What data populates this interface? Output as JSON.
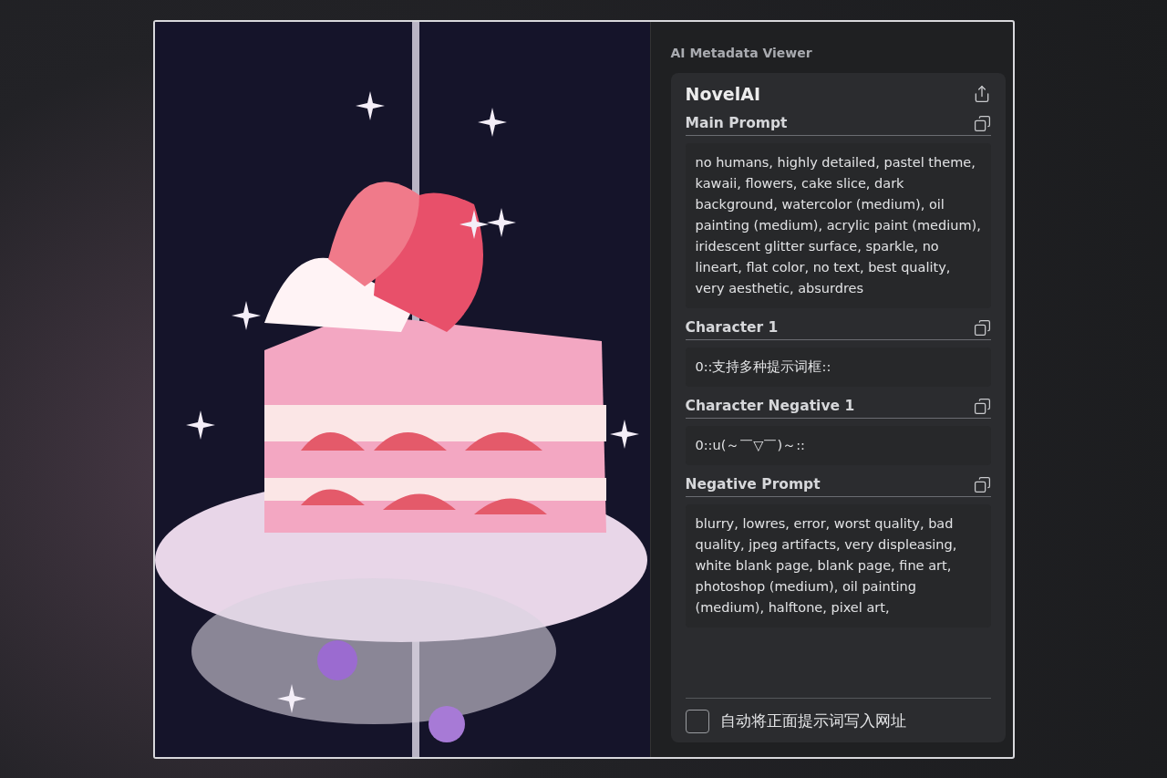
{
  "viewer": {
    "title": "AI Metadata Viewer",
    "source": "NovelAI",
    "sections": [
      {
        "heading": "Main Prompt",
        "text": "no humans, highly detailed, pastel theme, kawaii, flowers, cake slice, dark background, watercolor (medium), oil painting (medium), acrylic paint (medium), iridescent glitter surface, sparkle, no lineart, flat color, no text, best quality, very aesthetic, absurdres"
      },
      {
        "heading": "Character 1",
        "text": "0::支持多种提示词框::"
      },
      {
        "heading": "Character Negative 1",
        "text": "0::u(～￣▽￣)～::"
      },
      {
        "heading": "Negative Prompt",
        "text": "blurry, lowres, error, worst quality, bad quality, jpeg artifacts, very displeasing, white blank page, blank page, fine art, photoshop (medium), oil painting (medium), halftone, pixel art,"
      }
    ],
    "option": {
      "label": "自动将正面提示词写入网址",
      "checked": false
    }
  }
}
